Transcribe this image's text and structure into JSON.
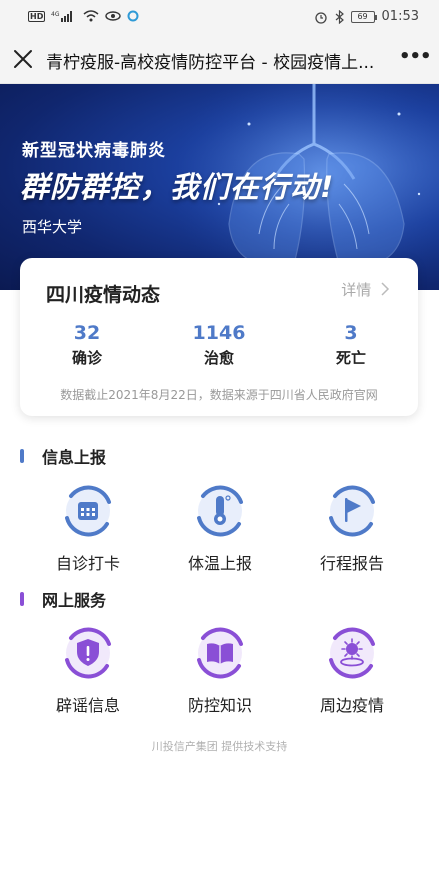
{
  "status_bar": {
    "hd": "HD",
    "net": "4G",
    "battery": "69",
    "time": "01:53"
  },
  "header": {
    "title": "青柠疫服-高校疫情防控平台 - 校园疫情上...",
    "more": "•••"
  },
  "banner": {
    "subtitle": "新型冠状病毒肺炎",
    "headline": "群防群控，我们在行动!",
    "school": "西华大学"
  },
  "card": {
    "title": "四川疫情动态",
    "detail_label": "详情",
    "stats": [
      {
        "value": "32",
        "label": "确诊"
      },
      {
        "value": "1146",
        "label": "治愈"
      },
      {
        "value": "3",
        "label": "死亡"
      }
    ],
    "note": "数据截止2021年8月22日，数据来源于四川省人民政府官网"
  },
  "sections": [
    {
      "title": "信息上报",
      "color": "#4f7ac8",
      "items": [
        {
          "label": "自诊打卡",
          "icon": "calendar-icon"
        },
        {
          "label": "体温上报",
          "icon": "thermometer-icon"
        },
        {
          "label": "行程报告",
          "icon": "flag-icon"
        }
      ]
    },
    {
      "title": "网上服务",
      "color": "#8a4fd6",
      "items": [
        {
          "label": "辟谣信息",
          "icon": "shield-icon"
        },
        {
          "label": "防控知识",
          "icon": "book-icon"
        },
        {
          "label": "周边疫情",
          "icon": "virus-icon"
        }
      ]
    }
  ],
  "footer": "川投信产集团 提供技术支持",
  "colors": {
    "accent_blue": "#4f7ac8",
    "accent_purple": "#8a4fd6",
    "banner_dark": "#0b1a52"
  }
}
